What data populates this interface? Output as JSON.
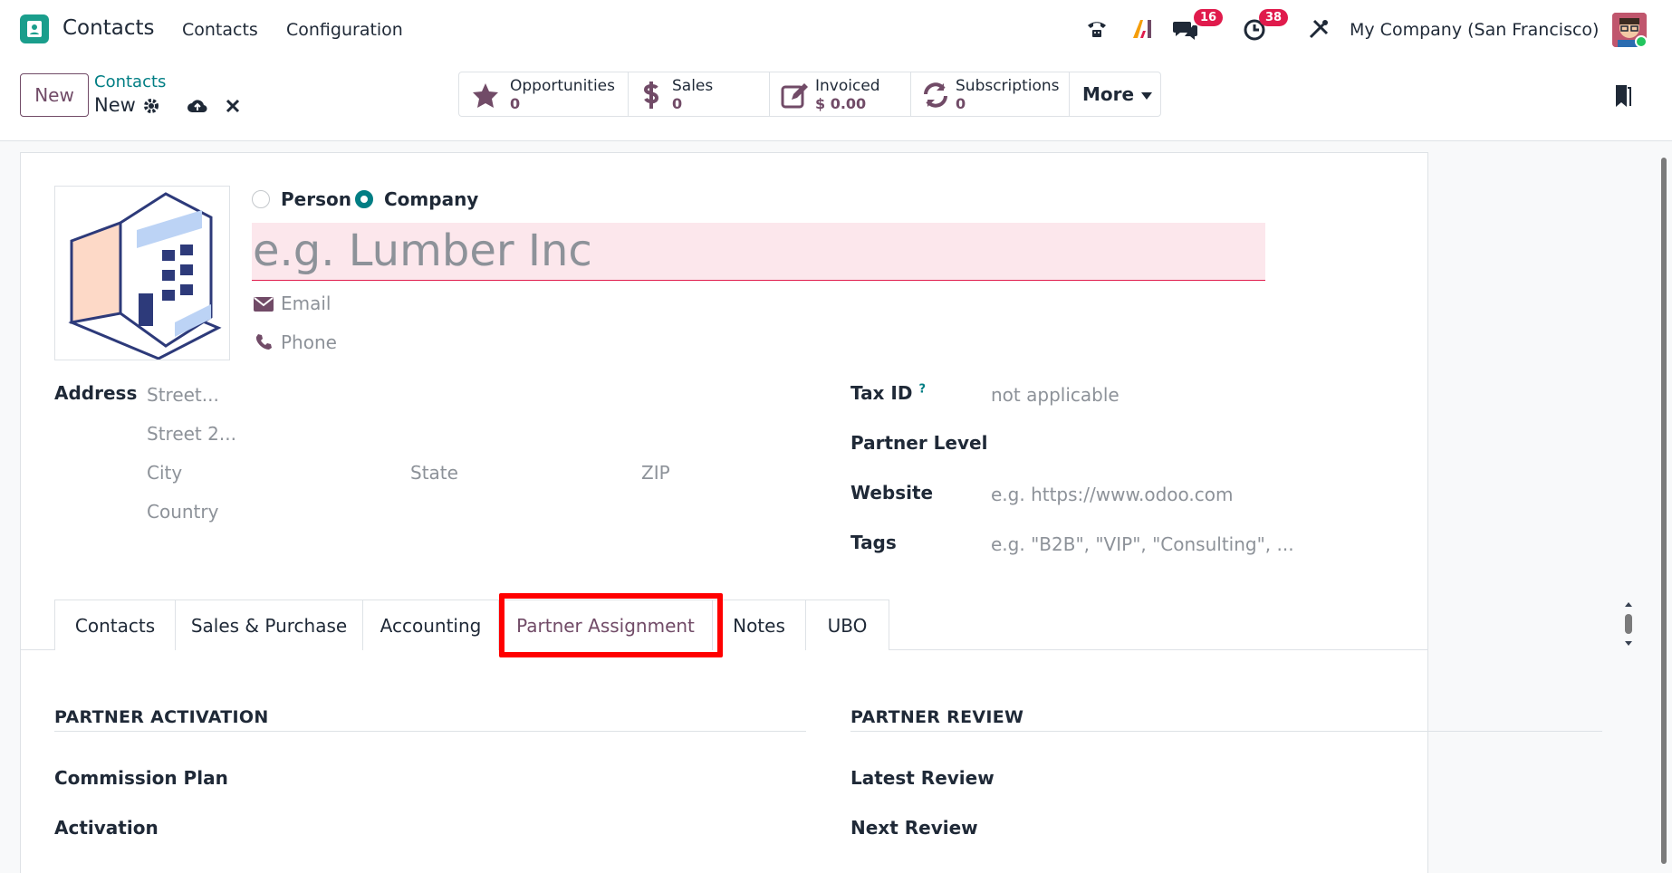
{
  "navbar": {
    "app_name": "Contacts",
    "menu": [
      "Contacts",
      "Configuration"
    ],
    "messages_count": "16",
    "activities_count": "38",
    "company": "My Company (San Francisco)"
  },
  "control": {
    "new_label": "New",
    "breadcrumb_parent": "Contacts",
    "breadcrumb_current": "New"
  },
  "stats": [
    {
      "label": "Opportunities",
      "value": "0",
      "icon": "star-icon"
    },
    {
      "label": "Sales",
      "value": "0",
      "icon": "dollar-icon"
    },
    {
      "label": "Invoiced",
      "value": "$ 0.00",
      "icon": "edit-icon"
    },
    {
      "label": "Subscriptions",
      "value": "0",
      "icon": "refresh-icon"
    }
  ],
  "more_label": "More",
  "form": {
    "type_options": [
      "Person",
      "Company"
    ],
    "selected_type": "Company",
    "name_placeholder": "e.g. Lumber Inc",
    "email_placeholder": "Email",
    "phone_placeholder": "Phone",
    "address_label": "Address",
    "street_placeholder": "Street...",
    "street2_placeholder": "Street 2...",
    "city_placeholder": "City",
    "state_placeholder": "State",
    "zip_placeholder": "ZIP",
    "country_placeholder": "Country",
    "tax_id_label": "Tax ID",
    "tax_id_help": "?",
    "tax_id_value": "not applicable",
    "partner_level_label": "Partner Level",
    "website_label": "Website",
    "website_placeholder": "e.g. https://www.odoo.com",
    "tags_label": "Tags",
    "tags_placeholder": "e.g. \"B2B\", \"VIP\", \"Consulting\", ..."
  },
  "tabs": [
    "Contacts",
    "Sales & Purchase",
    "Accounting",
    "Partner Assignment",
    "Notes",
    "UBO"
  ],
  "active_tab": "Partner Assignment",
  "partner_activation": {
    "title": "PARTNER ACTIVATION",
    "fields": [
      "Commission Plan",
      "Activation"
    ]
  },
  "partner_review": {
    "title": "PARTNER REVIEW",
    "fields": [
      "Latest Review",
      "Next Review"
    ]
  },
  "colors": {
    "brand": "#714b67",
    "accent": "#017e84",
    "highlight": "#ff0000",
    "badge": "#e01b4c"
  }
}
